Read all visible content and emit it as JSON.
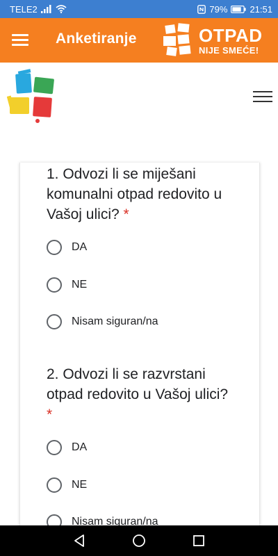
{
  "status_bar": {
    "carrier": "TELE2",
    "battery": "79%",
    "time": "21:51"
  },
  "app_bar": {
    "title": "Anketiranje",
    "brand_line1": "OTPAD",
    "brand_line2": "NIJE SMEĆE!"
  },
  "colors": {
    "status_bar": "#3d7fd0",
    "app_bar": "#f57f20",
    "required": "#d93025"
  },
  "questions": [
    {
      "text": "1. Odvozi li se miješani komunalni otpad redovito u Vašoj ulici?",
      "required_mark": "*",
      "options": [
        "DA",
        "NE",
        "Nisam siguran/na"
      ]
    },
    {
      "text": "2. Odvozi li se razvrstani otpad redovito u Vašoj ulici?",
      "required_mark": "*",
      "options": [
        "DA",
        "NE",
        "Nisam siguran/na"
      ]
    }
  ],
  "nav": {
    "back_icon": "back-triangle-icon",
    "home_icon": "home-circle-icon",
    "recents_icon": "recents-square-icon"
  }
}
